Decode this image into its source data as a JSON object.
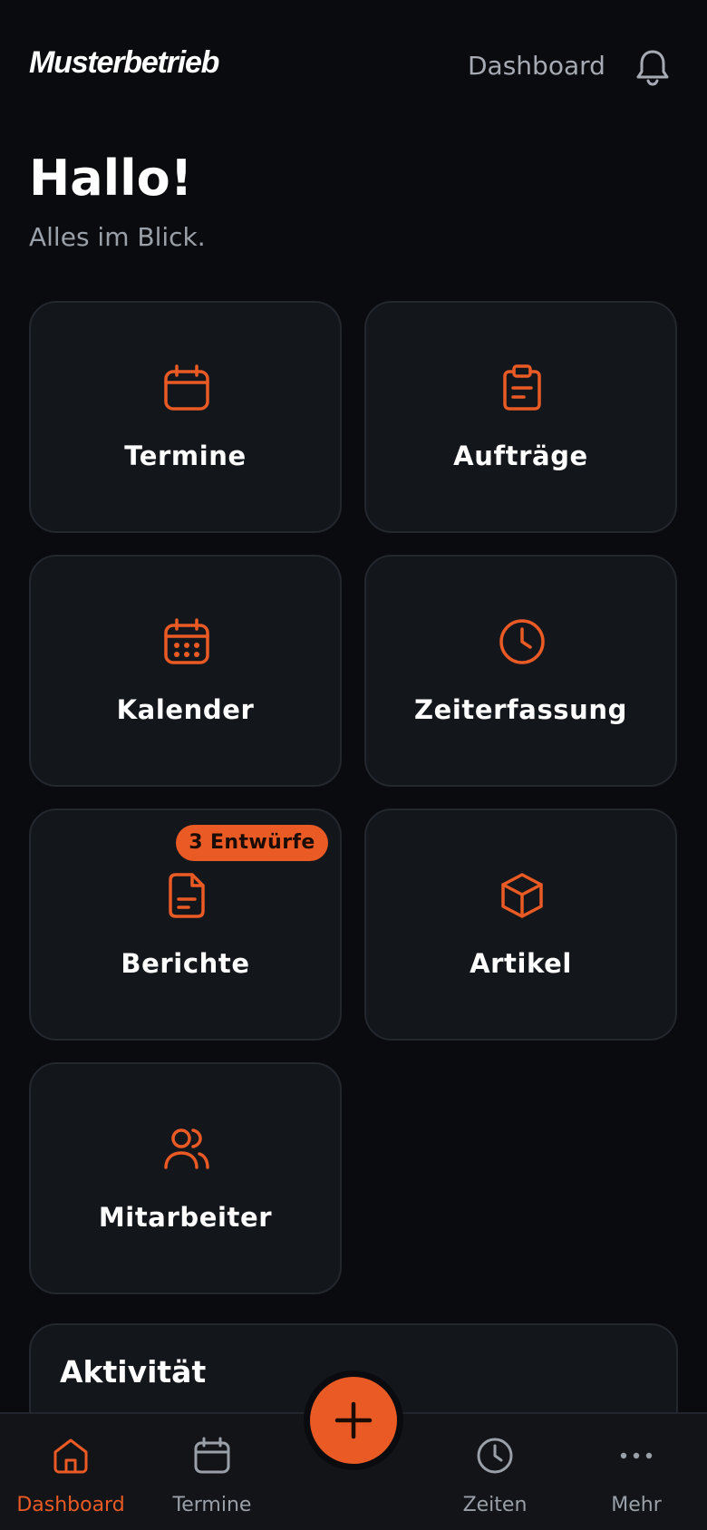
{
  "app": {
    "brand": "Musterbetrieb",
    "header_title": "Dashboard",
    "accent_color": "#ea5a24"
  },
  "header": {
    "notifications_icon": "bell-icon"
  },
  "greeting": {
    "title": "Hallo!",
    "subtitle": "Alles im Blick."
  },
  "tiles": [
    {
      "label": "Termine",
      "icon": "calendar-icon"
    },
    {
      "label": "Aufträge",
      "icon": "clipboard-icon"
    },
    {
      "label": "Kalender",
      "icon": "calendar-grid-icon"
    },
    {
      "label": "Zeiterfassung",
      "icon": "clock-icon"
    },
    {
      "label": "Berichte",
      "icon": "document-icon",
      "badge": "3 Entwürfe"
    },
    {
      "label": "Artikel",
      "icon": "box-icon"
    },
    {
      "label": "Mitarbeiter",
      "icon": "users-icon"
    }
  ],
  "activity": {
    "title": "Aktivität"
  },
  "bottom_nav": {
    "items": [
      {
        "label": "Dashboard",
        "icon": "home-icon",
        "active": true
      },
      {
        "label": "Termine",
        "icon": "calendar-icon",
        "active": false
      },
      {
        "label": "Zeiten",
        "icon": "clock-icon",
        "active": false
      },
      {
        "label": "Mehr",
        "icon": "more-icon",
        "active": false
      }
    ],
    "fab_icon": "plus-icon"
  }
}
